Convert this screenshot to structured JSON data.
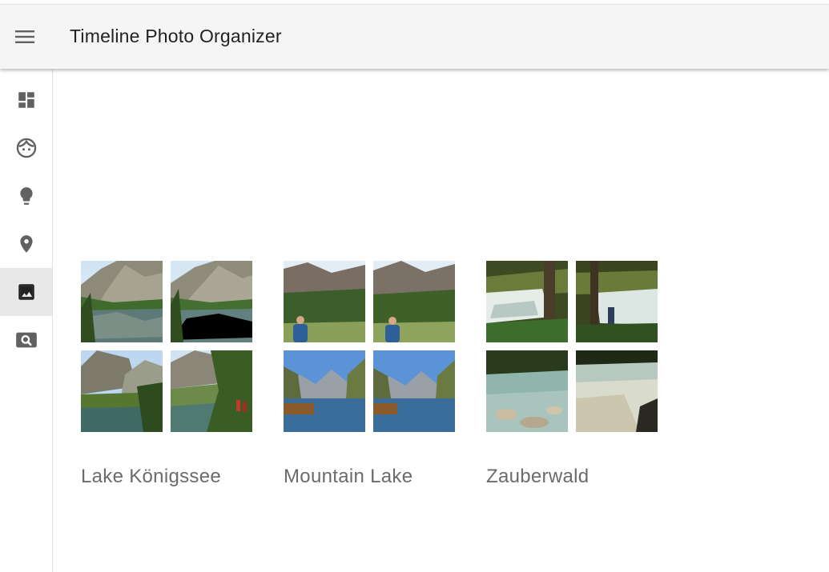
{
  "app": {
    "title": "Timeline Photo Organizer",
    "menu_icon": "menu-icon"
  },
  "sidebar": {
    "items": [
      {
        "id": "dashboard",
        "icon": "dashboard-icon",
        "active": false
      },
      {
        "id": "people",
        "icon": "face-icon",
        "active": false
      },
      {
        "id": "ideas",
        "icon": "lightbulb-icon",
        "active": false
      },
      {
        "id": "places",
        "icon": "location-pin-icon",
        "active": false
      },
      {
        "id": "albums",
        "icon": "photo-album-icon",
        "active": true
      },
      {
        "id": "search",
        "icon": "image-search-icon",
        "active": false
      }
    ]
  },
  "albums": [
    {
      "title": "Lake Königssee",
      "photo_count": 4
    },
    {
      "title": "Mountain Lake",
      "photo_count": 4
    },
    {
      "title": "Zauberwald",
      "photo_count": 4
    }
  ],
  "colors": {
    "topbar_bg": "#f5f5f5",
    "active_item_bg": "#e8e8e8",
    "icon": "#616161",
    "album_title": "#6b6b6b"
  }
}
